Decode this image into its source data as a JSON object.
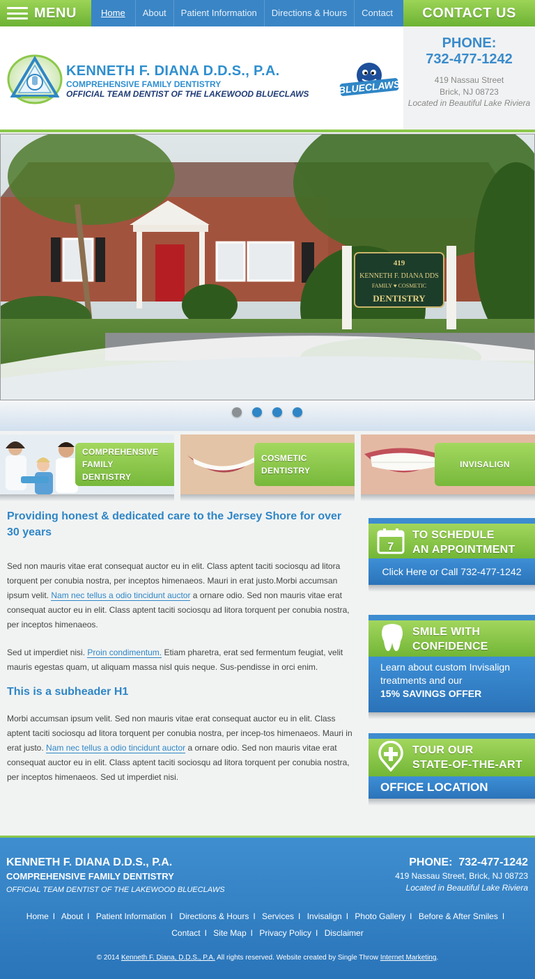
{
  "nav": {
    "menu_label": "MENU",
    "items": [
      "Home",
      "About",
      "Patient Information",
      "Directions & Hours",
      "Contact"
    ],
    "contact_us": "CONTACT US"
  },
  "header": {
    "title": "KENNETH F. DIANA D.D.S., P.A.",
    "subtitle": "COMPREHENSIVE FAMILY DENTISTRY",
    "tagline": "OFFICIAL TEAM DENTIST OF THE LAKEWOOD BLUECLAWS",
    "blueclaws_logo_text": "BLUECLAWS",
    "phone_label": "PHONE:",
    "phone": "732-477-1242",
    "address1": "419 Nassau Street",
    "address2": "Brick, NJ 08723",
    "location_note": "Located in Beautiful Lake Riviera"
  },
  "slider": {
    "sign_number": "419",
    "sign_name": "KENNETH F. DIANA DDS",
    "sign_line2": "FAMILY ♥ COSMETIC",
    "sign_line3": "DENTISTRY",
    "slide_count": 4,
    "active_index": 0
  },
  "services": [
    {
      "label_lines": [
        "COMPREHENSIVE",
        "FAMILY",
        "DENTISTRY"
      ]
    },
    {
      "label_lines": [
        "COSMETIC DENTISTRY"
      ]
    },
    {
      "label_lines": [
        "INVISALIGN"
      ]
    }
  ],
  "content": {
    "heading": "Providing honest & dedicated care to the Jersey Shore for over 30 years",
    "p1_a": "Sed non mauris vitae erat consequat auctor eu in elit. Class aptent taciti sociosqu ad litora torquent per conubia nostra, per inceptos himenaeos. Mauri in erat justo.Morbi accumsan ipsum velit. ",
    "p1_link": "Nam nec tellus a odio tincidunt auctor",
    "p1_b": " a ornare odio. Sed non  mauris vitae erat consequat auctor eu in elit. Class aptent taciti sociosqu ad litora torquent per conubia nostra, per inceptos himenaeos.",
    "p2_a": "Sed ut imperdiet nisi. ",
    "p2_link": "Proin condimentum.",
    "p2_b": " Etiam pharetra, erat sed fermentum feugiat, velit mauris egestas quam, ut aliquam massa nisl quis neque. Sus-pendisse in orci enim.",
    "subheader": "This is a subheader H1",
    "p3_a": "Morbi accumsan ipsum velit. Sed non  mauris vitae erat consequat auctor eu in elit. Class aptent taciti sociosqu ad litora torquent per conubia nostra, per incep-tos himenaeos. Mauri in erat justo.  ",
    "p3_link": "Nam nec tellus a odio tincidunt auctor",
    "p3_b": " a ornare odio. Sed non  mauris vitae erat consequat auctor eu in elit. Class aptent taciti sociosqu ad litora torquent per conubia nostra, per inceptos himenaeos. Sed ut imperdiet nisi."
  },
  "sidebar": {
    "appointment": {
      "icon_day": "7",
      "line1": "TO SCHEDULE",
      "line2": "AN APPOINTMENT",
      "cta": "Click Here or Call 732-477-1242"
    },
    "smile": {
      "line1": "SMILE WITH",
      "line2": "CONFIDENCE",
      "body1": "Learn about custom Invisalign",
      "body2": "treatments and our",
      "offer": "15% SAVINGS OFFER"
    },
    "tour": {
      "line1": "TOUR OUR",
      "line2": "STATE-OF-THE-ART",
      "cta": "OFFICE LOCATION"
    }
  },
  "footer": {
    "title": "KENNETH F. DIANA D.D.S., P.A.",
    "subtitle": "COMPREHENSIVE FAMILY DENTISTRY",
    "tagline": "OFFICIAL TEAM DENTIST OF THE LAKEWOOD BLUECLAWS",
    "phone_label": "PHONE:",
    "phone": "732-477-1242",
    "address": "419 Nassau Street, Brick, NJ 08723",
    "location_note": "Located in Beautiful Lake Riviera",
    "nav1": [
      "Home",
      "About",
      "Patient Information",
      "Directions & Hours",
      "Services",
      "Invisalign",
      "Photo Gallery",
      "Before & After Smiles"
    ],
    "nav2": [
      "Contact",
      "Site Map",
      "Privacy Policy",
      "Disclaimer"
    ],
    "copy_a": "© 2014 ",
    "copy_link1": "Kenneth F. Diana, D.D.S., P.A.",
    "copy_b": " All rights reserved. Website created by Single Throw ",
    "copy_link2": "Internet Marketing",
    "copy_c": "."
  },
  "colors": {
    "accent_blue": "#2f86c6",
    "brand_green": "#7cbd3e",
    "navy": "#1f3b76"
  }
}
